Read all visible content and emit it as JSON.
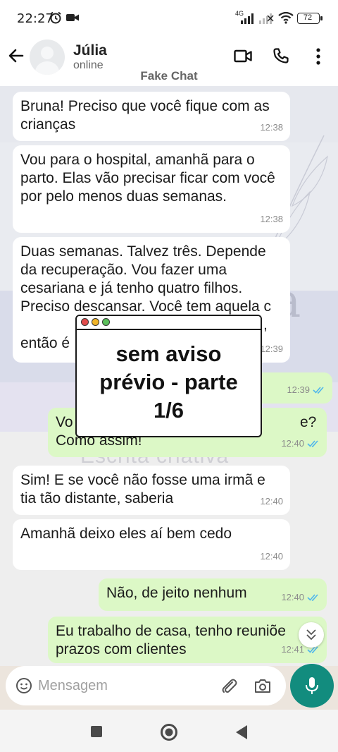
{
  "status_bar": {
    "time": "22:27",
    "battery": "72",
    "network_label": "4G"
  },
  "header": {
    "contact_name": "Júlia",
    "presence": "online",
    "app_name": "Fake Chat"
  },
  "messages": [
    {
      "dir": "in",
      "text": "Bruna! Preciso que você fique com as crianças",
      "time": "12:38"
    },
    {
      "dir": "in",
      "text": "Vou para o hospital, amanhã para o parto. Elas vão precisar ficar com você por pelo menos duas semanas.",
      "time": "12:38"
    },
    {
      "dir": "in",
      "text": "Duas semanas. Talvez três. Depende da recuperação. Vou fazer uma cesariana e já tenho quatro filhos. Preciso descansar. Você tem aquela c",
      "text_tail": ",",
      "last_line": "então é",
      "time": "12:39"
    },
    {
      "dir": "out",
      "text": "",
      "time": "12:39"
    },
    {
      "dir": "out",
      "text_left": "Vo",
      "text_right": "e?",
      "last_line": "Como assim!",
      "time": "12:40"
    },
    {
      "dir": "in",
      "text": "Sim! E se você não fosse uma irmã e tia tão distante, saberia",
      "time": "12:40"
    },
    {
      "dir": "in",
      "text": "Amanhã deixo eles aí bem cedo",
      "time": "12:40"
    },
    {
      "dir": "out",
      "text": "Não, de jeito nenhum",
      "time": "12:40"
    },
    {
      "dir": "out",
      "text": "Eu trabalho de casa, tenho reuniõe prazos com clientes",
      "time": "12:41"
    }
  ],
  "overlay": {
    "line1": "sem aviso",
    "line2": "prévio - parte",
    "line3": "1/6"
  },
  "watermark": {
    "letter": "a",
    "caption": "Escrita criativa"
  },
  "input": {
    "placeholder": "Mensagem"
  },
  "colors": {
    "chat_bg": "#ece5dd",
    "incoming_bubble": "#ffffff",
    "outgoing_bubble": "#dcf8c6",
    "accent": "#128c7e",
    "read_ticks": "#4fb6ec"
  }
}
